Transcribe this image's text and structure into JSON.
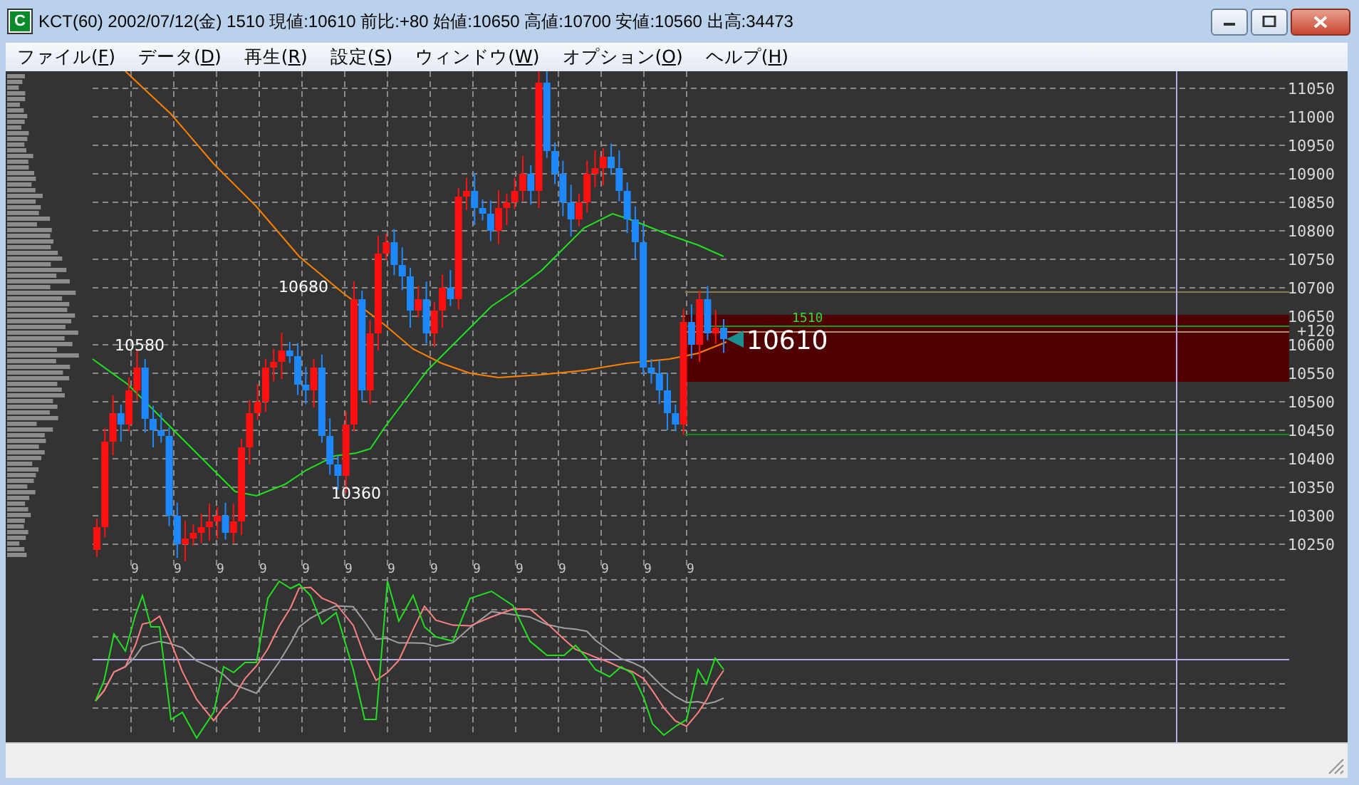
{
  "window": {
    "title": "KCT(60) 2002/07/12(金) 1510 現値:10610 前比:+80  始値:10650 高値:10700 安値:10560 出高:34473",
    "app_icon": "C"
  },
  "menu": [
    "ファイル(F)",
    "データ(D)",
    "再生(R)",
    "設定(S)",
    "ウィンドウ(W)",
    "オプション(O)",
    "ヘルプ(H)"
  ],
  "chart": {
    "price_labels": [
      "11050",
      "11000",
      "10950",
      "10900",
      "10850",
      "10800",
      "10750",
      "10700",
      "10650",
      "10600",
      "10550",
      "10500",
      "10450",
      "10400",
      "10350",
      "10300",
      "10250"
    ],
    "date_labels": [
      "9",
      "9",
      "9",
      "9",
      "9",
      "9",
      "9",
      "9",
      "9",
      "9",
      "9",
      "9",
      "9",
      "9"
    ],
    "peak_labels": [
      "10580",
      "10680",
      "10360"
    ],
    "current_price": "10610",
    "volume_label": "1510",
    "change_label": "+120"
  }
}
